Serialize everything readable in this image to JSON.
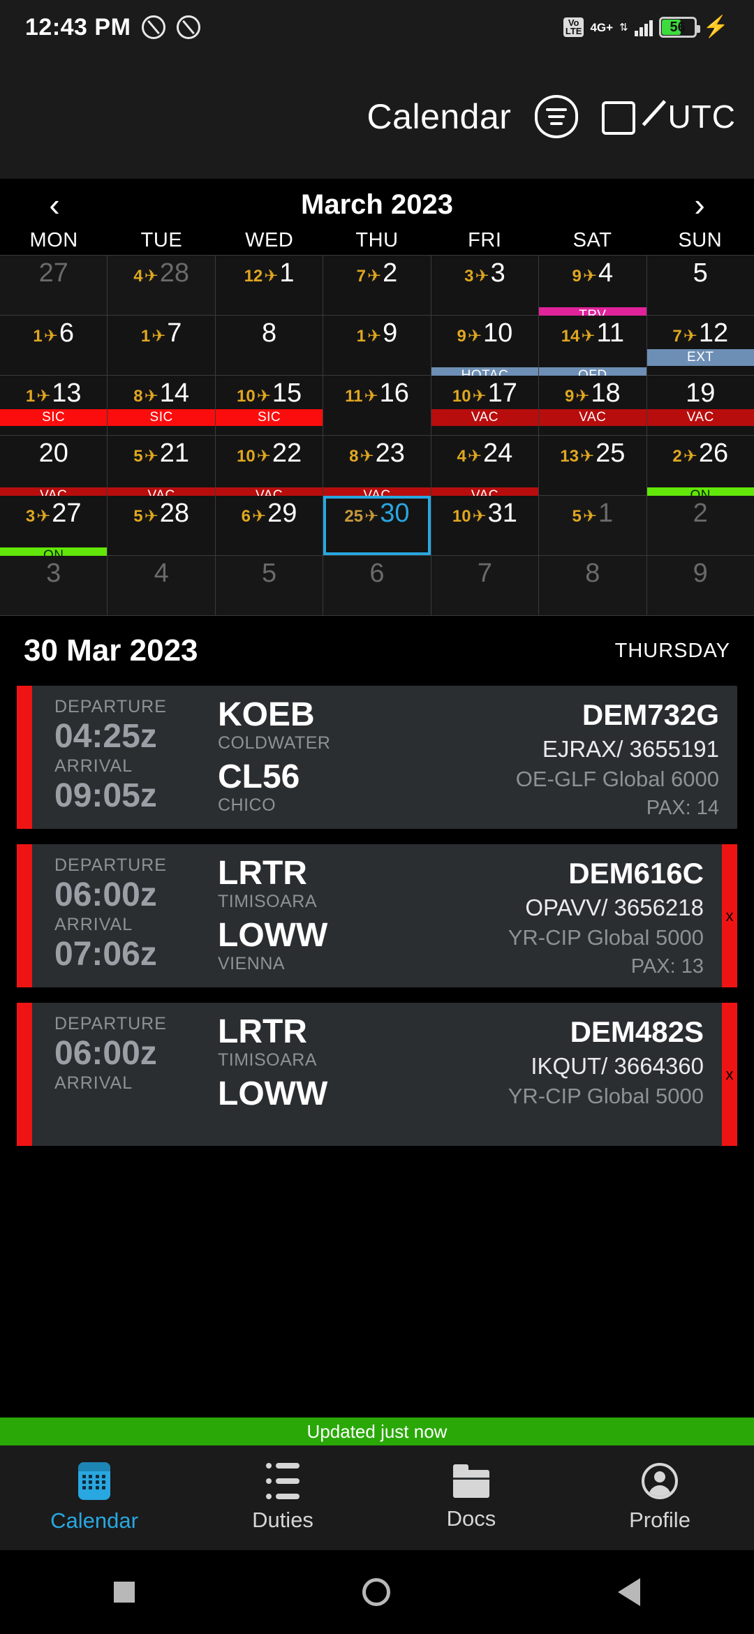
{
  "status_bar": {
    "clock": "12:43 PM",
    "icons": [
      "dnd-icon",
      "dnd-icon"
    ],
    "volte_top": "Vo",
    "volte_bottom": "LTE",
    "network": "4G+",
    "network_arrows": "⇅",
    "battery_percent": "56",
    "battery_fill": "56%",
    "charging_icon": "⚡",
    "battery_color": "#3ddc3d"
  },
  "app_bar": {
    "title": "Calendar",
    "filter_icon": "filter-list-icon",
    "edit_icon": "compose-edit-icon",
    "timezone": "UTC"
  },
  "month_nav": {
    "prev_icon": "‹",
    "next_icon": "›",
    "month_label": "March 2023",
    "weekdays": [
      "MON",
      "TUE",
      "WED",
      "THU",
      "FRI",
      "SAT",
      "SUN"
    ]
  },
  "legend_colors": {
    "trv": "#e0239b",
    "hotac": "#6e8fb5",
    "ofd": "#6e8fb5",
    "ext": "#6e8fb5",
    "sic": "#fb0d0d",
    "vac": "#b80d0d",
    "on": "#63e609",
    "selected_border": "#29a7e0",
    "flight_count": "#e0a721"
  },
  "calendar": {
    "weeks": [
      [
        {
          "day": "27",
          "out": true,
          "flights": "",
          "badge": null
        },
        {
          "day": "28",
          "out": true,
          "flights": "4",
          "badge": null
        },
        {
          "day": "1",
          "out": false,
          "flights": "12",
          "badge": null
        },
        {
          "day": "2",
          "out": false,
          "flights": "7",
          "badge": null
        },
        {
          "day": "3",
          "out": false,
          "flights": "3",
          "badge": null
        },
        {
          "day": "4",
          "out": false,
          "flights": "9",
          "badge": {
            "label": "TRV",
            "color": "#e0239b",
            "row": 2
          }
        },
        {
          "day": "5",
          "out": false,
          "flights": "",
          "badge": null
        }
      ],
      [
        {
          "day": "6",
          "out": false,
          "flights": "1",
          "badge": null
        },
        {
          "day": "7",
          "out": false,
          "flights": "1",
          "badge": null
        },
        {
          "day": "8",
          "out": false,
          "flights": "",
          "badge": null
        },
        {
          "day": "9",
          "out": false,
          "flights": "1",
          "badge": null
        },
        {
          "day": "10",
          "out": false,
          "flights": "9",
          "badge": {
            "label": "HOTAC",
            "color": "#6e8fb5",
            "row": 2
          }
        },
        {
          "day": "11",
          "out": false,
          "flights": "14",
          "badge": {
            "label": "OFD",
            "color": "#6e8fb5",
            "row": 2
          }
        },
        {
          "day": "12",
          "out": false,
          "flights": "7",
          "badge": {
            "label": "EXT",
            "color": "#6e8fb5",
            "row": 1
          }
        }
      ],
      [
        {
          "day": "13",
          "out": false,
          "flights": "1",
          "badge": {
            "label": "SIC",
            "color": "#fb0d0d",
            "row": 1
          }
        },
        {
          "day": "14",
          "out": false,
          "flights": "8",
          "badge": {
            "label": "SIC",
            "color": "#fb0d0d",
            "row": 1
          }
        },
        {
          "day": "15",
          "out": false,
          "flights": "10",
          "badge": {
            "label": "SIC",
            "color": "#fb0d0d",
            "row": 1
          }
        },
        {
          "day": "16",
          "out": false,
          "flights": "11",
          "badge": null
        },
        {
          "day": "17",
          "out": false,
          "flights": "10",
          "badge": {
            "label": "VAC",
            "color": "#b80d0d",
            "row": 1
          }
        },
        {
          "day": "18",
          "out": false,
          "flights": "9",
          "badge": {
            "label": "VAC",
            "color": "#b80d0d",
            "row": 1
          }
        },
        {
          "day": "19",
          "out": false,
          "flights": "",
          "badge": {
            "label": "VAC",
            "color": "#b80d0d",
            "row": 1
          }
        }
      ],
      [
        {
          "day": "20",
          "out": false,
          "flights": "",
          "badge": {
            "label": "VAC",
            "color": "#b80d0d",
            "row": 2
          }
        },
        {
          "day": "21",
          "out": false,
          "flights": "5",
          "badge": {
            "label": "VAC",
            "color": "#b80d0d",
            "row": 2
          }
        },
        {
          "day": "22",
          "out": false,
          "flights": "10",
          "badge": {
            "label": "VAC",
            "color": "#b80d0d",
            "row": 2
          }
        },
        {
          "day": "23",
          "out": false,
          "flights": "8",
          "badge": {
            "label": "VAC",
            "color": "#b80d0d",
            "row": 2
          }
        },
        {
          "day": "24",
          "out": false,
          "flights": "4",
          "badge": {
            "label": "VAC",
            "color": "#b80d0d",
            "row": 2
          }
        },
        {
          "day": "25",
          "out": false,
          "flights": "13",
          "badge": null
        },
        {
          "day": "26",
          "out": false,
          "flights": "2",
          "badge": {
            "label": "ON",
            "color": "#63e609",
            "row": 2
          }
        }
      ],
      [
        {
          "day": "27",
          "out": false,
          "flights": "3",
          "badge": {
            "label": "ON",
            "color": "#63e609",
            "row": 2
          }
        },
        {
          "day": "28",
          "out": false,
          "flights": "5",
          "badge": null
        },
        {
          "day": "29",
          "out": false,
          "flights": "6",
          "badge": null
        },
        {
          "day": "30",
          "out": false,
          "flights": "25",
          "badge": null,
          "selected": true
        },
        {
          "day": "31",
          "out": false,
          "flights": "10",
          "badge": null
        },
        {
          "day": "1",
          "out": true,
          "flights": "5",
          "badge": null
        },
        {
          "day": "2",
          "out": true,
          "flights": "",
          "badge": null
        }
      ],
      [
        {
          "day": "3",
          "out": true,
          "flights": "",
          "badge": null
        },
        {
          "day": "4",
          "out": true,
          "flights": "",
          "badge": null
        },
        {
          "day": "5",
          "out": true,
          "flights": "",
          "badge": null
        },
        {
          "day": "6",
          "out": true,
          "flights": "",
          "badge": null
        },
        {
          "day": "7",
          "out": true,
          "flights": "",
          "badge": null
        },
        {
          "day": "8",
          "out": true,
          "flights": "",
          "badge": null
        },
        {
          "day": "9",
          "out": true,
          "flights": "",
          "badge": null
        }
      ]
    ]
  },
  "day_detail": {
    "date": "30 Mar 2023",
    "weekday": "THURSDAY",
    "labels": {
      "departure": "DEPARTURE",
      "arrival": "ARRIVAL"
    },
    "flights": [
      {
        "departure_time": "04:25z",
        "arrival_time": "09:05z",
        "from_code": "KOEB",
        "from_city": "COLDWATER",
        "to_code": "CL56",
        "to_city": "CHICO",
        "trip": "DEM732G",
        "crew": "EJRAX/ 3655191",
        "aircraft": "OE-GLF Global 6000",
        "pax": "PAX: 14",
        "left_bar": "#ef1414",
        "right_bar": null,
        "right_bar_label": ""
      },
      {
        "departure_time": "06:00z",
        "arrival_time": "07:06z",
        "from_code": "LRTR",
        "from_city": "TIMISOARA",
        "to_code": "LOWW",
        "to_city": "VIENNA",
        "trip": "DEM616C",
        "crew": "OPAVV/ 3656218",
        "aircraft": "YR-CIP Global 5000",
        "pax": "PAX: 13",
        "left_bar": "#ef1414",
        "right_bar": "#ef1414",
        "right_bar_label": "x"
      },
      {
        "departure_time": "06:00z",
        "arrival_time": "",
        "from_code": "LRTR",
        "from_city": "TIMISOARA",
        "to_code": "LOWW",
        "to_city": "",
        "trip": "DEM482S",
        "crew": "IKQUT/ 3664360",
        "aircraft": "YR-CIP Global 5000",
        "pax": "",
        "left_bar": "#ef1414",
        "right_bar": "#ef1414",
        "right_bar_label": "x"
      }
    ]
  },
  "toast": {
    "message": "Updated just now",
    "color": "#2aa808"
  },
  "bottom_nav": {
    "items": [
      {
        "label": "Calendar",
        "icon": "calendar-icon",
        "active": true
      },
      {
        "label": "Duties",
        "icon": "list-icon",
        "active": false
      },
      {
        "label": "Docs",
        "icon": "folder-icon",
        "active": false
      },
      {
        "label": "Profile",
        "icon": "person-icon",
        "active": false
      }
    ]
  },
  "system_nav": {
    "recent_icon": "square-recents-icon",
    "home_icon": "circle-home-icon",
    "back_icon": "triangle-back-icon"
  }
}
